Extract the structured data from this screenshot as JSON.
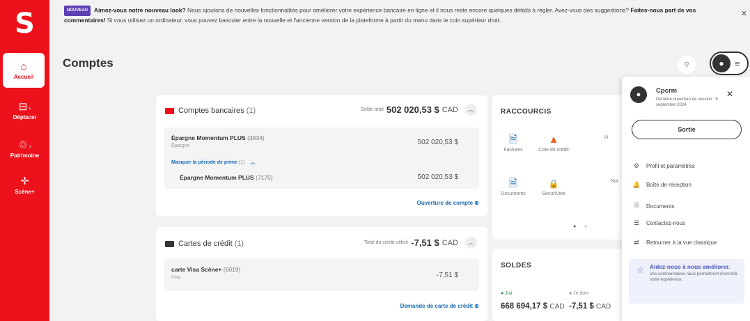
{
  "sidebar": {
    "logo": "S",
    "items": [
      {
        "label": "Accueil",
        "icon": "home-icon",
        "glyph": "⌂"
      },
      {
        "label": "Déplacer",
        "icon": "transfer-icon",
        "glyph": "⊟"
      },
      {
        "label": "Patrimoine",
        "icon": "wealth-icon",
        "glyph": "♲"
      },
      {
        "label": "Scène+",
        "icon": "scene-plus-icon",
        "glyph": "✛"
      }
    ]
  },
  "banner": {
    "badge": "NOUVEAU",
    "headline": "Aimez-vous notre nouveau look?",
    "text1": " Nous ajoutons de nouvelles fonctionnalités pour améliorer votre expérience bancaire en ligne et il nous reste encore quelques détails à régler. Avez-vous des suggestions? ",
    "link": "Faites-nous part de vos commentaires!",
    "text2": " Si vous utilisez un ordinateur, vous pouvez basculer entre la nouvelle et l'ancienne version de la plateforme à partir du menu dans le coin supérieur droit.",
    "close": "✕"
  },
  "page": {
    "title": "Comptes"
  },
  "bank_accounts": {
    "title": "Comptes bancaires",
    "count": "(1)",
    "total_label": "Solde total",
    "total_value": "502 020,53 $",
    "currency": "CAD",
    "account": {
      "name": "Épargne Momentum PLUS",
      "number": "(3834)",
      "type": "Épargne",
      "balance": "502 020,53 $"
    },
    "hide_bonus": "Masquer la période de prime",
    "hide_bonus_count": "(1)",
    "sub_account": {
      "name": "Épargne Momentum PLUS",
      "number": "(7175)",
      "balance": "502 020,53 $"
    },
    "open_link": "Ouverture de compte ⊕"
  },
  "credit_cards": {
    "title": "Cartes de crédit",
    "count": "(1)",
    "total_label": "Total du crédit utilisé",
    "total_value": "-7,51 $",
    "currency": "CAD",
    "card": {
      "name": "carte Visa Scène+",
      "number": "(6019)",
      "type": "Visa",
      "balance": "-7,51 $"
    },
    "apply_link": "Demande de carte de crédit ⊕"
  },
  "shortcuts": {
    "title": "RACCOURCIS",
    "items": [
      {
        "label": "Factures",
        "icon": "bills-icon",
        "glyph": "🗎",
        "color": "#1b6ab1"
      },
      {
        "label": "Cote de crédit",
        "icon": "credit-score-icon",
        "glyph": "▲",
        "color": "#e8601c"
      },
      {
        "label": "Vi",
        "icon": "partial-icon",
        "glyph": "",
        "color": "#e8a21c"
      },
      {
        "label": "Documents",
        "icon": "documents-icon",
        "glyph": "🗎",
        "color": "#1b6ab1"
      },
      {
        "label": "SecuriVoie",
        "icon": "lock-icon",
        "glyph": "🔒",
        "color": "#1b6ab1"
      },
      {
        "label": "Noi",
        "icon": "partial-icon",
        "glyph": "",
        "color": "#777777"
      }
    ],
    "dots": "● ○"
  },
  "balances": {
    "title": "SOLDES",
    "have_label": "● J'ai",
    "have_value": "668 694,17 $",
    "have_currency": "CAD",
    "owe_label": "● Je dois",
    "owe_value": "-7,51 $",
    "owe_currency": "CAD"
  },
  "profile_menu": {
    "name": "Cpcrm",
    "last_open": "Dernière ouverture de session : 9 septembre 2024",
    "logout": "Sortie",
    "items": [
      {
        "label": "Profil et paramètres",
        "icon": "gear-icon",
        "glyph": "⚙"
      },
      {
        "label": "Boîte de réception",
        "icon": "bell-icon",
        "glyph": "🔔"
      },
      {
        "label": "Documents",
        "icon": "document-icon",
        "glyph": "🗎"
      },
      {
        "label": "Contactez-nous",
        "icon": "chat-icon",
        "glyph": "☰"
      },
      {
        "label": "Retourner à la vue classique",
        "icon": "swap-icon",
        "glyph": "⇄"
      }
    ],
    "help_title": "Aidez-nous à nous améliorer.",
    "help_desc": "Vos commentaires nous permettront d'enrichir votre expérience."
  },
  "colors": {
    "brand": "#ec111a",
    "link": "#1b6ab1",
    "accent": "#5b3fb3"
  }
}
